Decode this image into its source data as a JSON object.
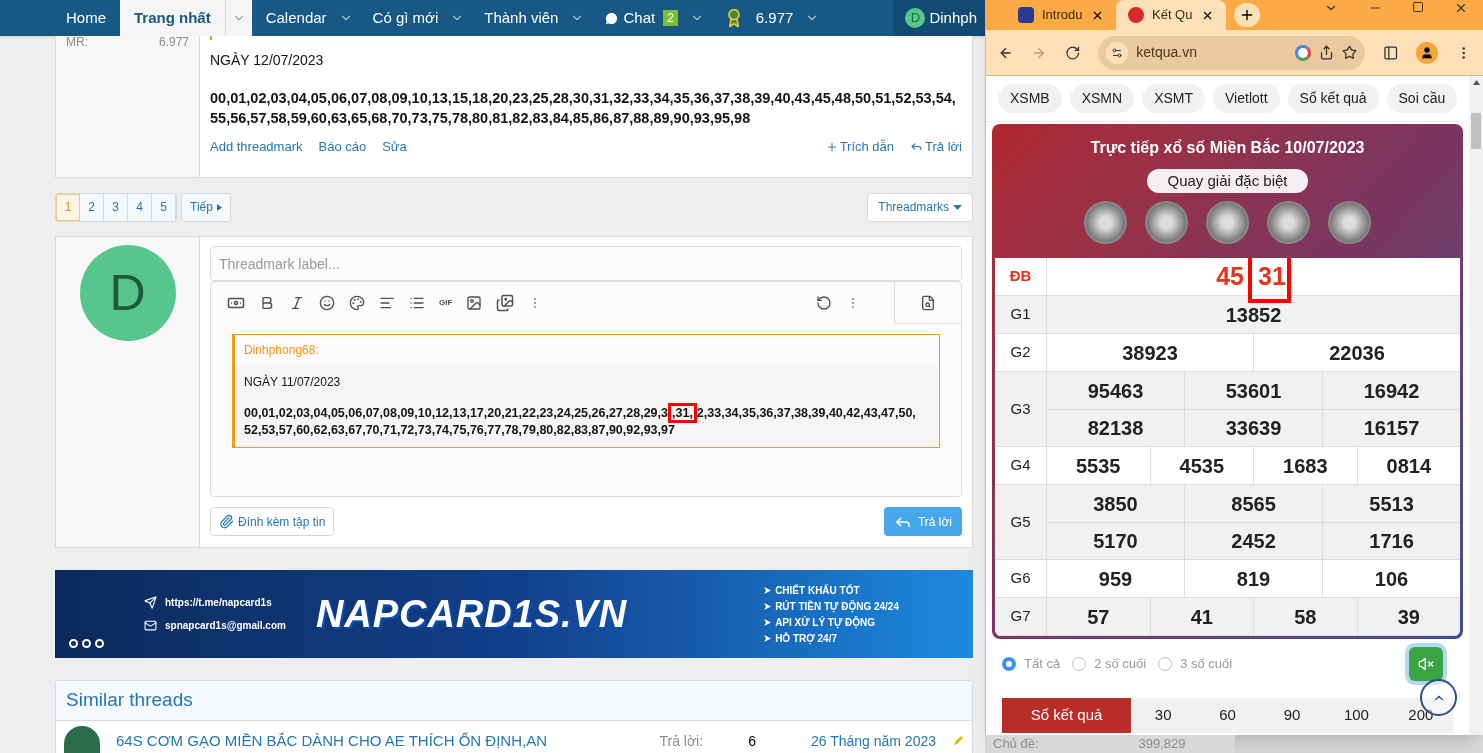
{
  "nav": {
    "items": [
      {
        "label": "Home",
        "selected": false,
        "dropdown": false,
        "kind": "text"
      },
      {
        "label": "Trang nhất",
        "selected": true,
        "dropdown": true,
        "kind": "text"
      },
      {
        "label": "Calendar",
        "selected": false,
        "dropdown": true,
        "kind": "text"
      },
      {
        "label": "Có gì mới",
        "selected": false,
        "dropdown": true,
        "kind": "text"
      },
      {
        "label": "Thành viên",
        "selected": false,
        "dropdown": true,
        "kind": "text"
      },
      {
        "label": "Chat",
        "selected": false,
        "dropdown": true,
        "kind": "chat",
        "badge": "2"
      },
      {
        "label": "6.977",
        "selected": false,
        "dropdown": true,
        "kind": "points"
      }
    ],
    "user": {
      "initial": "D",
      "name": "Dinhph"
    }
  },
  "post": {
    "user_stat_label": "MR:",
    "user_stat_value": "6.977",
    "date": "NGÀY 12/07/2023",
    "numbers": "00,01,02,03,04,05,06,07,08,09,10,13,15,18,20,23,25,28,30,31,32,33,34,35,36,37,38,39,40,43,45,48,50,51,52,53,54,55,56,57,58,59,60,63,65,68,70,73,75,78,80,81,82,83,84,85,86,87,88,89,90,93,95,98",
    "actions_left": [
      "Add threadmark",
      "Báo cáo",
      "Sửa"
    ],
    "quote_action": "Trích dẫn",
    "reply_action": "Trả lời"
  },
  "pagination": {
    "pages": [
      {
        "label": "1",
        "selected": true
      },
      {
        "label": "2",
        "selected": false
      },
      {
        "label": "3",
        "selected": false
      },
      {
        "label": "4",
        "selected": false
      },
      {
        "label": "5",
        "selected": false
      }
    ],
    "next": "Tiếp",
    "threadmarks": "Threadmarks"
  },
  "reply": {
    "avatar_initial": "D",
    "toolbar_gif": "GIF",
    "threadmark_placeholder": "Threadmark label...",
    "quote": {
      "author": "Dinhphong68:",
      "date": "NGÀY 11/07/2023",
      "numbers_before": "00,01,02,03,04,05,06,07,08,09,10,12,13,17,20,21,22,23,24,25,26,27,28,29,3",
      "numbers_highlight": ",31,",
      "numbers_after": "2,33,34,35,36,37,38,39,40,42,43,47,50,52,53,57,60,62,63,67,70,71,72,73,74,75,76,77,78,79,80,82,83,87,90,92,93,97"
    },
    "attach": "Đính kèm tập tin",
    "submit": "Trả lời"
  },
  "banner": {
    "telegram": "https://t.me/napcard1s",
    "email": "spnapcard1s@gmail.com",
    "logo": "NAPCARD1S.VN",
    "features": [
      "CHIẾT KHẤU TỐT",
      "RÚT TIỀN TỰ ĐỘNG 24/24",
      "API XỬ LÝ TỰ ĐỘNG",
      "HỖ TRỢ 24/7"
    ]
  },
  "similar": {
    "title": "Similar threads",
    "threads": [
      {
        "title": "64S CƠM GẠO MIỀN BẮC DÀNH CHO AE THÍCH ỔN ĐỊNH,AN",
        "replies_label": "Trả lời:",
        "replies": "6",
        "date": "26 Tháng năm 2023"
      }
    ]
  },
  "behind": {
    "label": "Chủ đề:",
    "value": "399,829"
  },
  "browser": {
    "tabs": [
      {
        "title": "Introdu",
        "selected": false
      },
      {
        "title": "Kết Qu",
        "selected": true
      }
    ],
    "url": "ketqua.vn",
    "forward_disabled": true,
    "chips": [
      "XSMB",
      "XSMN",
      "XSMT",
      "Vietlott",
      "Sổ kết quả",
      "Soi cầu"
    ],
    "result": {
      "title": "Trực tiếp xổ số Miền Bắc 10/07/2023",
      "spin": "Quay giải đặc biệt",
      "prizes": [
        {
          "label": "ĐB",
          "kind": "special",
          "prefix": "45",
          "highlight": "31"
        },
        {
          "label": "G1",
          "kind": "normal",
          "lines": [
            [
              "13852"
            ]
          ]
        },
        {
          "label": "G2",
          "kind": "normal",
          "lines": [
            [
              "38923",
              "22036"
            ]
          ]
        },
        {
          "label": "G3",
          "kind": "normal",
          "lines": [
            [
              "95463",
              "53601",
              "16942"
            ],
            [
              "82138",
              "33639",
              "16157"
            ]
          ]
        },
        {
          "label": "G4",
          "kind": "normal",
          "lines": [
            [
              "5535",
              "4535",
              "1683",
              "0814"
            ]
          ]
        },
        {
          "label": "G5",
          "kind": "normal",
          "lines": [
            [
              "3850",
              "8565",
              "5513"
            ],
            [
              "5170",
              "2452",
              "1716"
            ]
          ]
        },
        {
          "label": "G6",
          "kind": "normal",
          "lines": [
            [
              "959",
              "819",
              "106"
            ]
          ]
        },
        {
          "label": "G7",
          "kind": "normal",
          "lines": [
            [
              "57",
              "41",
              "58",
              "39"
            ]
          ]
        }
      ]
    },
    "filters": [
      {
        "label": "Tất cả",
        "selected": true
      },
      {
        "label": "2 số cuối",
        "selected": false
      },
      {
        "label": "3 số cuối",
        "selected": false
      }
    ],
    "sound_muted": true,
    "history": [
      {
        "label": "Sổ kết quả",
        "selected": true
      },
      {
        "label": "30",
        "selected": false
      },
      {
        "label": "60",
        "selected": false
      },
      {
        "label": "90",
        "selected": false
      },
      {
        "label": "100",
        "selected": false
      },
      {
        "label": "200",
        "selected": false
      }
    ]
  }
}
